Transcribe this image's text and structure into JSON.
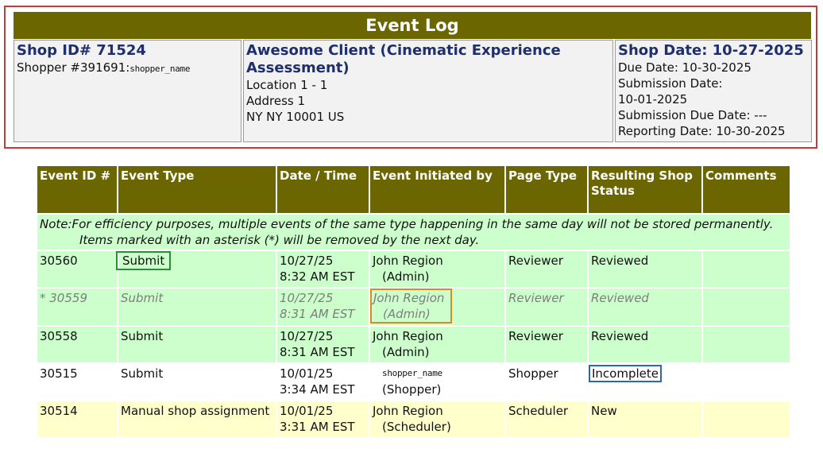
{
  "header": {
    "title": "Event Log",
    "shop_id": "Shop ID# 71524",
    "shopper_prefix": "Shopper #391691:",
    "shopper_name": "shopper_name",
    "client_line": "Awesome Client (Cinematic Experience Assessment)",
    "location": "Location 1 - 1",
    "address": "Address 1",
    "city": "NY NY 10001 US",
    "shop_date": "Shop Date: 10-27-2025",
    "due_date": "Due Date: 10-30-2025",
    "submission_date_label": "Submission Date:",
    "submission_date": "10-01-2025",
    "submission_due": "Submission Due Date: ---",
    "reporting_date": "Reporting Date: 10-30-2025"
  },
  "table": {
    "columns": [
      "Event ID #",
      "Event Type",
      "Date / Time",
      "Event Initiated by",
      "Page Type",
      "Resulting Shop Status",
      "Comments"
    ],
    "note_line1": "Note:For efficiency purposes, multiple events of the same type happening in the same day will not be stored permanently.",
    "note_line2": "Items marked with an asterisk (*) will be removed by the next day.",
    "rows": [
      {
        "id": "30560",
        "type": "Submit",
        "date": "10/27/25",
        "time": "8:32 AM EST",
        "by": "John Region",
        "role": "(Admin)",
        "page": "Reviewer",
        "status": "Reviewed",
        "comments": ""
      },
      {
        "id": "* 30559",
        "type": "Submit",
        "date": "10/27/25",
        "time": "8:31 AM EST",
        "by": "John Region",
        "role": "(Admin)",
        "page": "Reviewer",
        "status": "Reviewed",
        "comments": ""
      },
      {
        "id": "30558",
        "type": "Submit",
        "date": "10/27/25",
        "time": "8:31 AM EST",
        "by": "John Region",
        "role": "(Admin)",
        "page": "Reviewer",
        "status": "Reviewed",
        "comments": ""
      },
      {
        "id": "30515",
        "type": "Submit",
        "date": "10/01/25",
        "time": "3:34 AM EST",
        "by": "shopper_name",
        "role": "(Shopper)",
        "page": "Shopper",
        "status": "Incomplete",
        "comments": ""
      },
      {
        "id": "30514",
        "type": "Manual shop assignment",
        "date": "10/01/25",
        "time": "3:31 AM EST",
        "by": "John Region",
        "role": "(Scheduler)",
        "page": "Scheduler",
        "status": "New",
        "comments": ""
      }
    ]
  },
  "colors": {
    "header_bg": "#6b6600",
    "green_row": "#ccffcc",
    "yellow_row": "#ffffcc",
    "frame_red": "#c33b3b"
  }
}
